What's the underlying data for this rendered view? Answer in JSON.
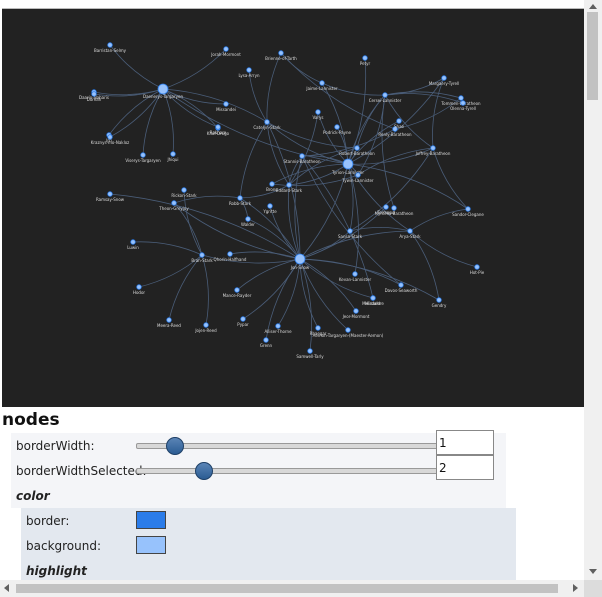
{
  "graph": {
    "colors": {
      "background": "#222222",
      "edge": "#4a5d78",
      "node_fill": "#97c2fc",
      "node_border": "#2b7ce9",
      "label": "#dddddd"
    },
    "nodes": [
      {
        "id": "daenerys",
        "label": "Daenerys-Targaryen",
        "hub": true
      },
      {
        "id": "jon",
        "label": "Jon-Snow",
        "hub": true
      },
      {
        "id": "tyrion",
        "label": "Tyrion-Lannister",
        "hub": true
      },
      {
        "id": "robb",
        "label": "Robb-Stark"
      },
      {
        "id": "bran",
        "label": "Bran-Stark"
      },
      {
        "id": "sansa",
        "label": "Sansa-Stark"
      },
      {
        "id": "arya",
        "label": "Arya-Stark"
      },
      {
        "id": "catelyn",
        "label": "Catelyn-Stark"
      },
      {
        "id": "cersei",
        "label": "Cersei-Lannister"
      },
      {
        "id": "jaime",
        "label": "Jaime-Lannister"
      },
      {
        "id": "joffrey",
        "label": "Joffrey-Baratheon"
      },
      {
        "id": "robert",
        "label": "Robert-Baratheon"
      },
      {
        "id": "stannis",
        "label": "Stannis-Baratheon"
      },
      {
        "id": "tywin",
        "label": "Tywin-Lannister"
      },
      {
        "id": "eddard",
        "label": "Eddard-Stark"
      },
      {
        "id": "sandor",
        "label": "Sandor-Clegane"
      },
      {
        "id": "barristan",
        "label": "Barristan-Selmy"
      },
      {
        "id": "jorah",
        "label": "Jorah-Mormont"
      },
      {
        "id": "daario",
        "label": "Daario-Naharis"
      },
      {
        "id": "missandei",
        "label": "Missandei"
      },
      {
        "id": "khal",
        "label": "Khal-Drogo"
      },
      {
        "id": "viserys",
        "label": "Viserys-Targaryen"
      },
      {
        "id": "jiqui",
        "label": "Jhiqui"
      },
      {
        "id": "irri",
        "label": "Irri"
      },
      {
        "id": "tommen",
        "label": "Tommen-Baratheon"
      },
      {
        "id": "margaery",
        "label": "Margaery-Tyrell"
      },
      {
        "id": "renly",
        "label": "Renly-Baratheon"
      },
      {
        "id": "petyr",
        "label": "Petyr"
      },
      {
        "id": "varys",
        "label": "Varys"
      },
      {
        "id": "lysa",
        "label": "Lysa-Arryn"
      },
      {
        "id": "bronn",
        "label": "Bronn"
      },
      {
        "id": "brienne",
        "label": "Brienne-of-Tarth"
      },
      {
        "id": "rickon",
        "label": "Rickon-Stark"
      },
      {
        "id": "theon",
        "label": "Theon-Greyjoy"
      },
      {
        "id": "ramsay",
        "label": "Ramsay-Snow"
      },
      {
        "id": "walder",
        "label": "Walder"
      },
      {
        "id": "samwell",
        "label": "Samwell-Tarly"
      },
      {
        "id": "meera",
        "label": "Meera-Reed"
      },
      {
        "id": "jojen",
        "label": "Jojen-Reed"
      },
      {
        "id": "hodor",
        "label": "Hodor"
      },
      {
        "id": "luwin",
        "label": "Luwin"
      },
      {
        "id": "mance",
        "label": "Mance-Rayder"
      },
      {
        "id": "ygritte",
        "label": "Ygritte"
      },
      {
        "id": "tormund",
        "label": "Tormund"
      },
      {
        "id": "davos",
        "label": "Davos-Seaworth"
      },
      {
        "id": "melisandre",
        "label": "Melisandre"
      },
      {
        "id": "gendry",
        "label": "Gendry"
      },
      {
        "id": "hotpie",
        "label": "Hot-Pie"
      },
      {
        "id": "jeor",
        "label": "Jeor-Mormont"
      },
      {
        "id": "aemon",
        "label": "Aemon-Targaryen-(Maester-Aemon)"
      },
      {
        "id": "alliser",
        "label": "Alliser-Thorne"
      },
      {
        "id": "grenn",
        "label": "Grenn"
      },
      {
        "id": "pypar",
        "label": "Pypar"
      },
      {
        "id": "qhorin",
        "label": "Qhorin-Halfhand"
      },
      {
        "id": "kevan",
        "label": "Kevan-Lannister"
      },
      {
        "id": "myrcella",
        "label": "Myrcella-Baratheon"
      },
      {
        "id": "olenna",
        "label": "Olenna-Tyrell"
      },
      {
        "id": "podrick",
        "label": "Podrick-Payne"
      },
      {
        "id": "shae",
        "label": "Shae"
      },
      {
        "id": "kraznys",
        "label": "Kraznys-mo-Nakloz"
      },
      {
        "id": "rhaegar",
        "label": "Rhaegar"
      },
      {
        "id": "doreah",
        "label": "Doreah"
      },
      {
        "id": "rakharo",
        "label": "Rakharo"
      },
      {
        "id": "hizdahr",
        "label": "Hizdahr"
      }
    ],
    "edges": [
      [
        "daenerys",
        "barristan"
      ],
      [
        "daenerys",
        "jorah"
      ],
      [
        "daenerys",
        "daario"
      ],
      [
        "daenerys",
        "missandei"
      ],
      [
        "daenerys",
        "khal"
      ],
      [
        "daenerys",
        "viserys"
      ],
      [
        "daenerys",
        "jiqui"
      ],
      [
        "daenerys",
        "irri"
      ],
      [
        "daenerys",
        "kraznys"
      ],
      [
        "daenerys",
        "rakharo"
      ],
      [
        "daenerys",
        "doreah"
      ],
      [
        "daenerys",
        "tyrion"
      ],
      [
        "daenerys",
        "catelyn"
      ],
      [
        "jon",
        "robb"
      ],
      [
        "jon",
        "bran"
      ],
      [
        "jon",
        "sansa"
      ],
      [
        "jon",
        "arya"
      ],
      [
        "jon",
        "catelyn"
      ],
      [
        "jon",
        "eddard"
      ],
      [
        "jon",
        "tyrion"
      ],
      [
        "jon",
        "samwell"
      ],
      [
        "jon",
        "mance"
      ],
      [
        "jon",
        "ygritte"
      ],
      [
        "jon",
        "tormund"
      ],
      [
        "jon",
        "jeor"
      ],
      [
        "jon",
        "aemon"
      ],
      [
        "jon",
        "alliser"
      ],
      [
        "jon",
        "grenn"
      ],
      [
        "jon",
        "pypar"
      ],
      [
        "jon",
        "qhorin"
      ],
      [
        "jon",
        "stannis"
      ],
      [
        "jon",
        "melisandre"
      ],
      [
        "jon",
        "davos"
      ],
      [
        "jon",
        "walder"
      ],
      [
        "jon",
        "theon"
      ],
      [
        "jon",
        "ramsay"
      ],
      [
        "jon",
        "gendry"
      ],
      [
        "jon",
        "rhaegar"
      ],
      [
        "tyrion",
        "cersei"
      ],
      [
        "tyrion",
        "jaime"
      ],
      [
        "tyrion",
        "tywin"
      ],
      [
        "tyrion",
        "joffrey"
      ],
      [
        "tyrion",
        "sansa"
      ],
      [
        "tyrion",
        "bronn"
      ],
      [
        "tyrion",
        "shae"
      ],
      [
        "tyrion",
        "podrick"
      ],
      [
        "tyrion",
        "varys"
      ],
      [
        "tyrion",
        "petyr"
      ],
      [
        "tyrion",
        "kevan"
      ],
      [
        "tyrion",
        "robert"
      ],
      [
        "tyrion",
        "catelyn"
      ],
      [
        "tyrion",
        "stannis"
      ],
      [
        "tyrion",
        "eddard"
      ],
      [
        "tyrion",
        "arya"
      ],
      [
        "tyrion",
        "sandor"
      ],
      [
        "tyrion",
        "margaery"
      ],
      [
        "cersei",
        "jaime"
      ],
      [
        "cersei",
        "joffrey"
      ],
      [
        "cersei",
        "tommen"
      ],
      [
        "cersei",
        "margaery"
      ],
      [
        "cersei",
        "tywin"
      ],
      [
        "cersei",
        "robert"
      ],
      [
        "cersei",
        "olenna"
      ],
      [
        "cersei",
        "myrcella"
      ],
      [
        "joffrey",
        "sansa"
      ],
      [
        "joffrey",
        "sandor"
      ],
      [
        "joffrey",
        "margaery"
      ],
      [
        "joffrey",
        "tywin"
      ],
      [
        "arya",
        "sandor"
      ],
      [
        "arya",
        "hotpie"
      ],
      [
        "arya",
        "gendry"
      ],
      [
        "arya",
        "sansa"
      ],
      [
        "robb",
        "catelyn"
      ],
      [
        "robb",
        "theon"
      ],
      [
        "robb",
        "walder"
      ],
      [
        "robb",
        "eddard"
      ],
      [
        "bran",
        "hodor"
      ],
      [
        "bran",
        "meera"
      ],
      [
        "bran",
        "jojen"
      ],
      [
        "bran",
        "luwin"
      ],
      [
        "bran",
        "rickon"
      ],
      [
        "bran",
        "theon"
      ],
      [
        "catelyn",
        "lysa"
      ],
      [
        "catelyn",
        "eddard"
      ],
      [
        "catelyn",
        "brienne"
      ],
      [
        "catelyn",
        "robert"
      ],
      [
        "eddard",
        "robert"
      ],
      [
        "eddard",
        "varys"
      ],
      [
        "eddard",
        "stannis"
      ],
      [
        "stannis",
        "davos"
      ],
      [
        "stannis",
        "melisandre"
      ],
      [
        "stannis",
        "renly"
      ],
      [
        "renly",
        "brienne"
      ],
      [
        "renly",
        "tommen"
      ],
      [
        "jaime",
        "brienne"
      ],
      [
        "bronn",
        "tywin"
      ]
    ]
  },
  "section": {
    "title": "nodes"
  },
  "config": {
    "border_width": {
      "label": "borderWidth:",
      "value": "1",
      "fraction": 0.125
    },
    "border_width_selected": {
      "label": "borderWidthSelected:",
      "value": "2",
      "fraction": 0.222
    },
    "color_heading": "color",
    "border_color": {
      "label": "border:",
      "color": "#2b7ce9"
    },
    "background_color": {
      "label": "background:",
      "color": "#97c2fc"
    },
    "highlight_heading": "highlight"
  },
  "scrollbars": {
    "vertical_fraction": 0.0,
    "horizontal_fraction": 0.0
  }
}
